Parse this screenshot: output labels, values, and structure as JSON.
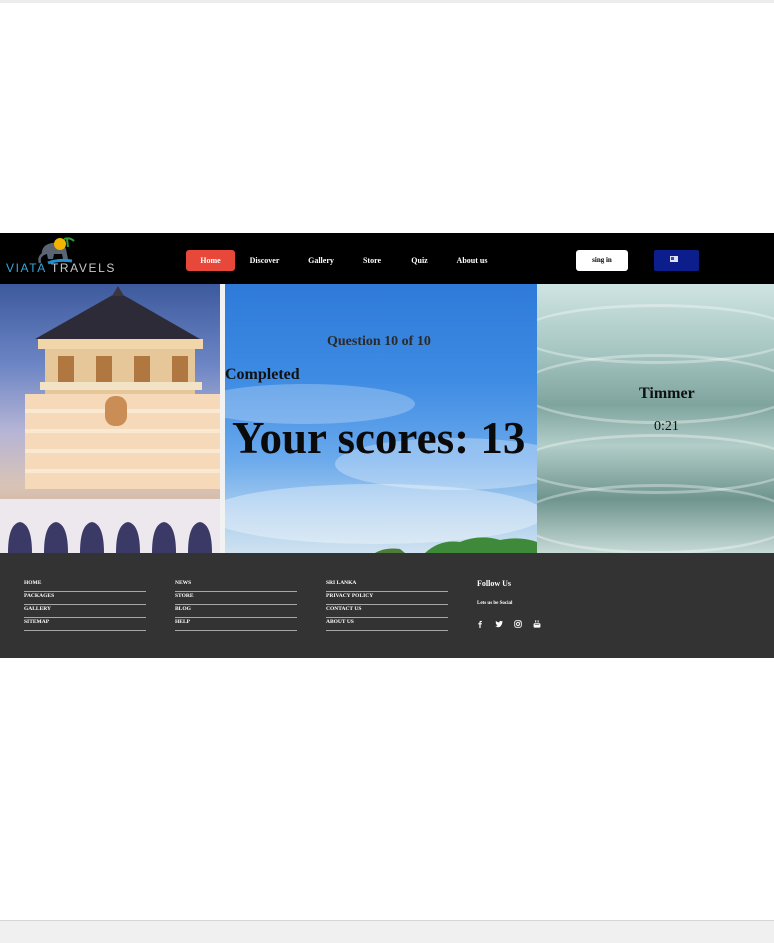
{
  "brand": {
    "part1": "VIATA",
    "part2": "TRAVELS"
  },
  "nav": {
    "items": [
      {
        "label": "Home",
        "active": true
      },
      {
        "label": "Discover"
      },
      {
        "label": "Gallery"
      },
      {
        "label": "Store"
      },
      {
        "label": "Quiz"
      },
      {
        "label": "About us"
      }
    ],
    "signin_label": "sing in",
    "language_icon": "flag-icon"
  },
  "quiz": {
    "progress": "Question 10 of 10",
    "status": "Completed",
    "score_text": "Your scores: 13"
  },
  "timer": {
    "title": "Timmer",
    "value": "0:21"
  },
  "footer": {
    "columns": [
      [
        "HOME",
        "PACKAGES",
        "GALLERY",
        "SITEMAP"
      ],
      [
        "NEWS",
        "STORE",
        "BLOG",
        "HELP"
      ],
      [
        "SRI LANKA",
        "PRIVACY POLICY",
        "CONTACT US",
        "ABOUT US"
      ]
    ],
    "follow_title": "Follow Us",
    "follow_sub": "Lets us be Social",
    "social_icons": [
      "facebook-icon",
      "twitter-icon",
      "instagram-icon",
      "youtube-icon"
    ]
  },
  "colors": {
    "active_nav": "#e8483a",
    "nav_bg": "#000000",
    "footer_bg": "#333333",
    "flag_bg": "#0c1e8c"
  }
}
